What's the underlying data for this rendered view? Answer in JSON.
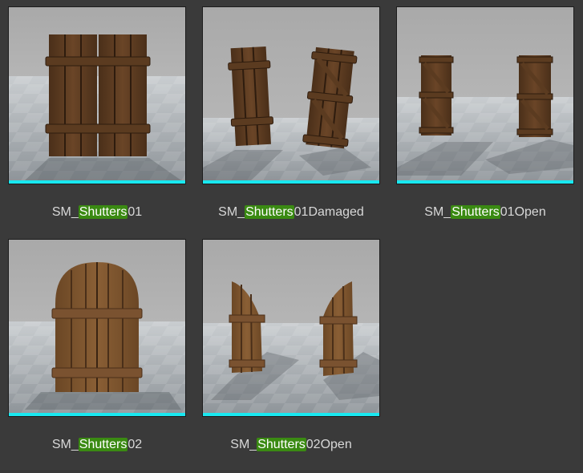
{
  "colors": {
    "background": "#3a3a3a",
    "accent_bar": "#19e8f0",
    "highlight": "#3a8a12",
    "label_text": "#d8d8d8"
  },
  "assets": [
    {
      "prefix": "SM_",
      "match": "Shutters",
      "suffix": "01",
      "icon": "shutters-closed-thumbnail"
    },
    {
      "prefix": "SM_",
      "match": "Shutters",
      "suffix": "01Damaged",
      "icon": "shutters-damaged-thumbnail"
    },
    {
      "prefix": "SM_",
      "match": "Shutters",
      "suffix": "01Open",
      "icon": "shutters-open-thumbnail"
    },
    {
      "prefix": "SM_",
      "match": "Shutters",
      "suffix": "02",
      "icon": "shutters-arched-thumbnail"
    },
    {
      "prefix": "SM_",
      "match": "Shutters",
      "suffix": "02Open",
      "icon": "shutters-arched-open-thumbnail"
    }
  ]
}
